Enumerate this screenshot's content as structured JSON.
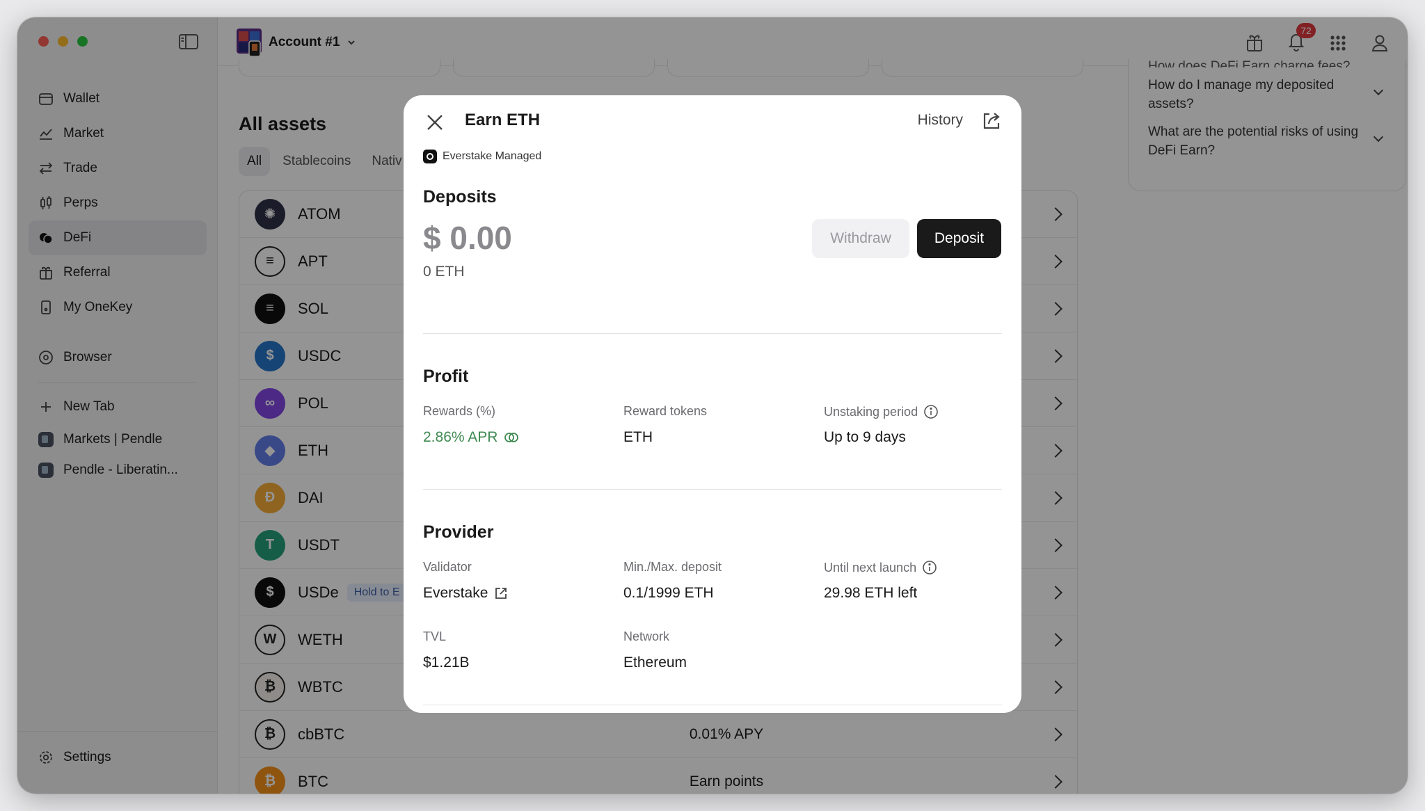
{
  "account": {
    "name": "Account #1"
  },
  "notifications": {
    "count": "72"
  },
  "sidebar": {
    "items": [
      {
        "label": "Wallet",
        "icon": "wallet-icon"
      },
      {
        "label": "Market",
        "icon": "chart-icon"
      },
      {
        "label": "Trade",
        "icon": "swap-icon"
      },
      {
        "label": "Perps",
        "icon": "candles-icon"
      },
      {
        "label": "DeFi",
        "icon": "defi-icon",
        "active": true
      },
      {
        "label": "Referral",
        "icon": "gift-icon"
      },
      {
        "label": "My OneKey",
        "icon": "device-icon"
      }
    ],
    "browser_label": "Browser",
    "new_tab_label": "New Tab",
    "tabs": [
      "Markets | Pendle",
      "Pendle - Liberatin..."
    ],
    "settings_label": "Settings"
  },
  "main": {
    "title": "All assets",
    "filter_tabs": [
      "All",
      "Stablecoins",
      "Nativ"
    ],
    "assets": [
      {
        "symbol": "ATOM",
        "color": "#2e3148",
        "glyph": "✺"
      },
      {
        "symbol": "APT",
        "color": "#ffffff",
        "glyph": "≡"
      },
      {
        "symbol": "SOL",
        "color": "#111111",
        "glyph": "≡"
      },
      {
        "symbol": "USDC",
        "color": "#2775ca",
        "glyph": "$"
      },
      {
        "symbol": "POL",
        "color": "#8247e5",
        "glyph": "∞"
      },
      {
        "symbol": "ETH",
        "color": "#627eea",
        "glyph": "◆"
      },
      {
        "symbol": "DAI",
        "color": "#f5ac37",
        "glyph": "Đ"
      },
      {
        "symbol": "USDT",
        "color": "#26a17b",
        "glyph": "T"
      },
      {
        "symbol": "USDe",
        "color": "#111111",
        "glyph": "$",
        "tag": "Hold to E"
      },
      {
        "symbol": "WETH",
        "color": "#ffffff",
        "glyph": "W"
      },
      {
        "symbol": "WBTC",
        "color": "#f4f0ea",
        "glyph": "₿"
      },
      {
        "symbol": "cbBTC",
        "color": "#ffffff",
        "glyph": "₿",
        "value": "0.01% APY"
      },
      {
        "symbol": "BTC",
        "color": "#f7931a",
        "glyph": "₿",
        "value": "Earn points"
      }
    ],
    "faq": [
      "How does DeFi Earn charge fees?",
      "How do I manage my deposited assets?",
      "What are the potential risks of using DeFi Earn?"
    ]
  },
  "modal": {
    "title": "Earn ETH",
    "history_label": "History",
    "provider_tag": "Everstake Managed",
    "deposits": {
      "title": "Deposits",
      "amount": "$ 0.00",
      "amount_eth": "0 ETH",
      "withdraw_label": "Withdraw",
      "deposit_label": "Deposit"
    },
    "profit": {
      "title": "Profit",
      "rewards_label": "Rewards (%)",
      "rewards_value": "2.86% APR",
      "reward_tokens_label": "Reward tokens",
      "reward_tokens_value": "ETH",
      "unstaking_label": "Unstaking period",
      "unstaking_value": "Up to 9 days"
    },
    "provider": {
      "title": "Provider",
      "validator_label": "Validator",
      "validator_value": "Everstake",
      "minmax_label": "Min./Max. deposit",
      "minmax_value": "0.1/1999 ETH",
      "next_launch_label": "Until next launch",
      "next_launch_value": "29.98 ETH left",
      "tvl_label": "TVL",
      "tvl_value": "$1.21B",
      "network_label": "Network",
      "network_value": "Ethereum"
    }
  },
  "colors": {
    "accent_green": "#3f8a52",
    "deposit_button": "#1a1a1a",
    "badge_red": "#e0393e"
  }
}
